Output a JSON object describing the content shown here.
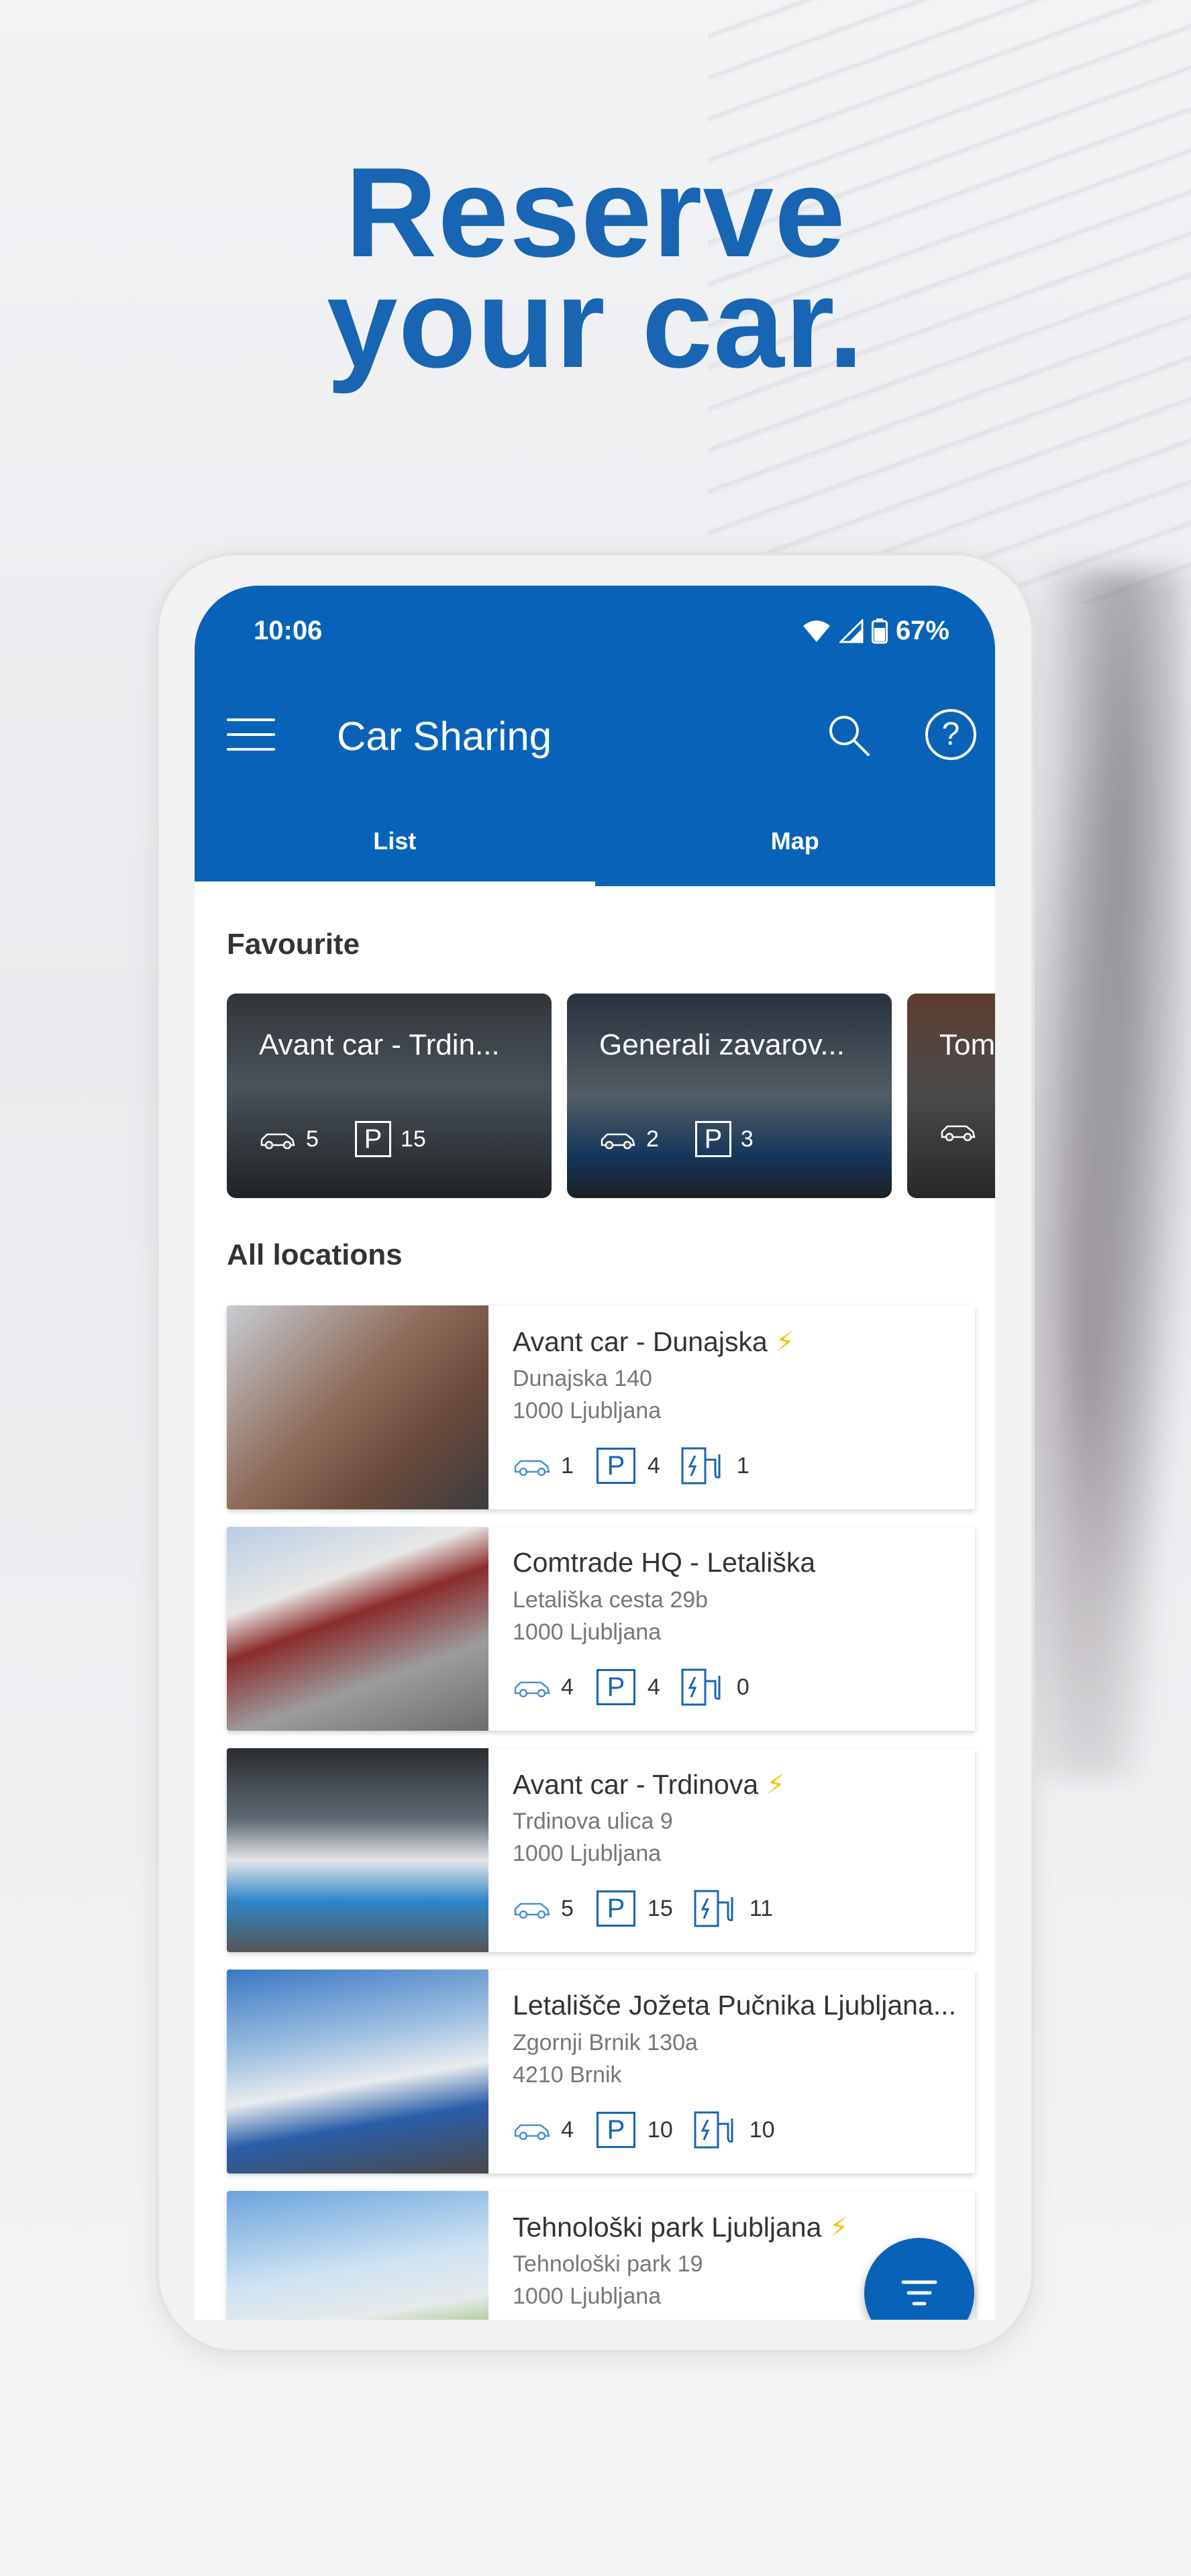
{
  "headline": {
    "line1": "Reserve",
    "line2": "your car."
  },
  "status_bar": {
    "time": "10:06",
    "battery": "67%"
  },
  "app": {
    "title": "Car Sharing"
  },
  "tabs": [
    {
      "label": "List",
      "active": true
    },
    {
      "label": "Map",
      "active": false
    }
  ],
  "colors": {
    "brand": "#0863b8",
    "headline": "#1765b3",
    "bolt": "#f3c316"
  },
  "favourites": {
    "title": "Favourite",
    "items": [
      {
        "name": "Avant car - Trdin...",
        "cars": "5",
        "parking": "15"
      },
      {
        "name": "Generali zavarov...",
        "cars": "2",
        "parking": "3"
      },
      {
        "name": "Tom",
        "cars": "",
        "parking": ""
      }
    ]
  },
  "locations": {
    "title": "All locations",
    "items": [
      {
        "name": "Avant car - Dunajska",
        "street": "Dunajska 140",
        "city": "1000 Ljubljana",
        "cars": "1",
        "parking": "4",
        "chargers": "1",
        "electric": true
      },
      {
        "name": "Comtrade HQ - Letališka",
        "street": "Letališka cesta 29b",
        "city": "1000 Ljubljana",
        "cars": "4",
        "parking": "4",
        "chargers": "0",
        "electric": false
      },
      {
        "name": "Avant car - Trdinova",
        "street": "Trdinova ulica 9",
        "city": "1000 Ljubljana",
        "cars": "5",
        "parking": "15",
        "chargers": "11",
        "electric": true
      },
      {
        "name": "Letališče Jožeta Pučnika Ljubljana...",
        "street": "Zgornji Brnik 130a",
        "city": "4210 Brnik",
        "cars": "4",
        "parking": "10",
        "chargers": "10",
        "electric": false
      },
      {
        "name": "Tehnološki park Ljubljana",
        "street": "Tehnološki park 19",
        "city": "1000 Ljubljana",
        "cars": "",
        "parking": "",
        "chargers": "",
        "electric": true
      }
    ]
  },
  "icons": {
    "menu": "hamburger-menu-icon",
    "search": "search-icon",
    "help": "help-icon",
    "car": "car-icon",
    "parking": "parking-icon",
    "charger": "ev-charger-icon",
    "filter": "filter-icon"
  },
  "symbols": {
    "parking": "P",
    "help": "?",
    "bolt": "⚡"
  }
}
